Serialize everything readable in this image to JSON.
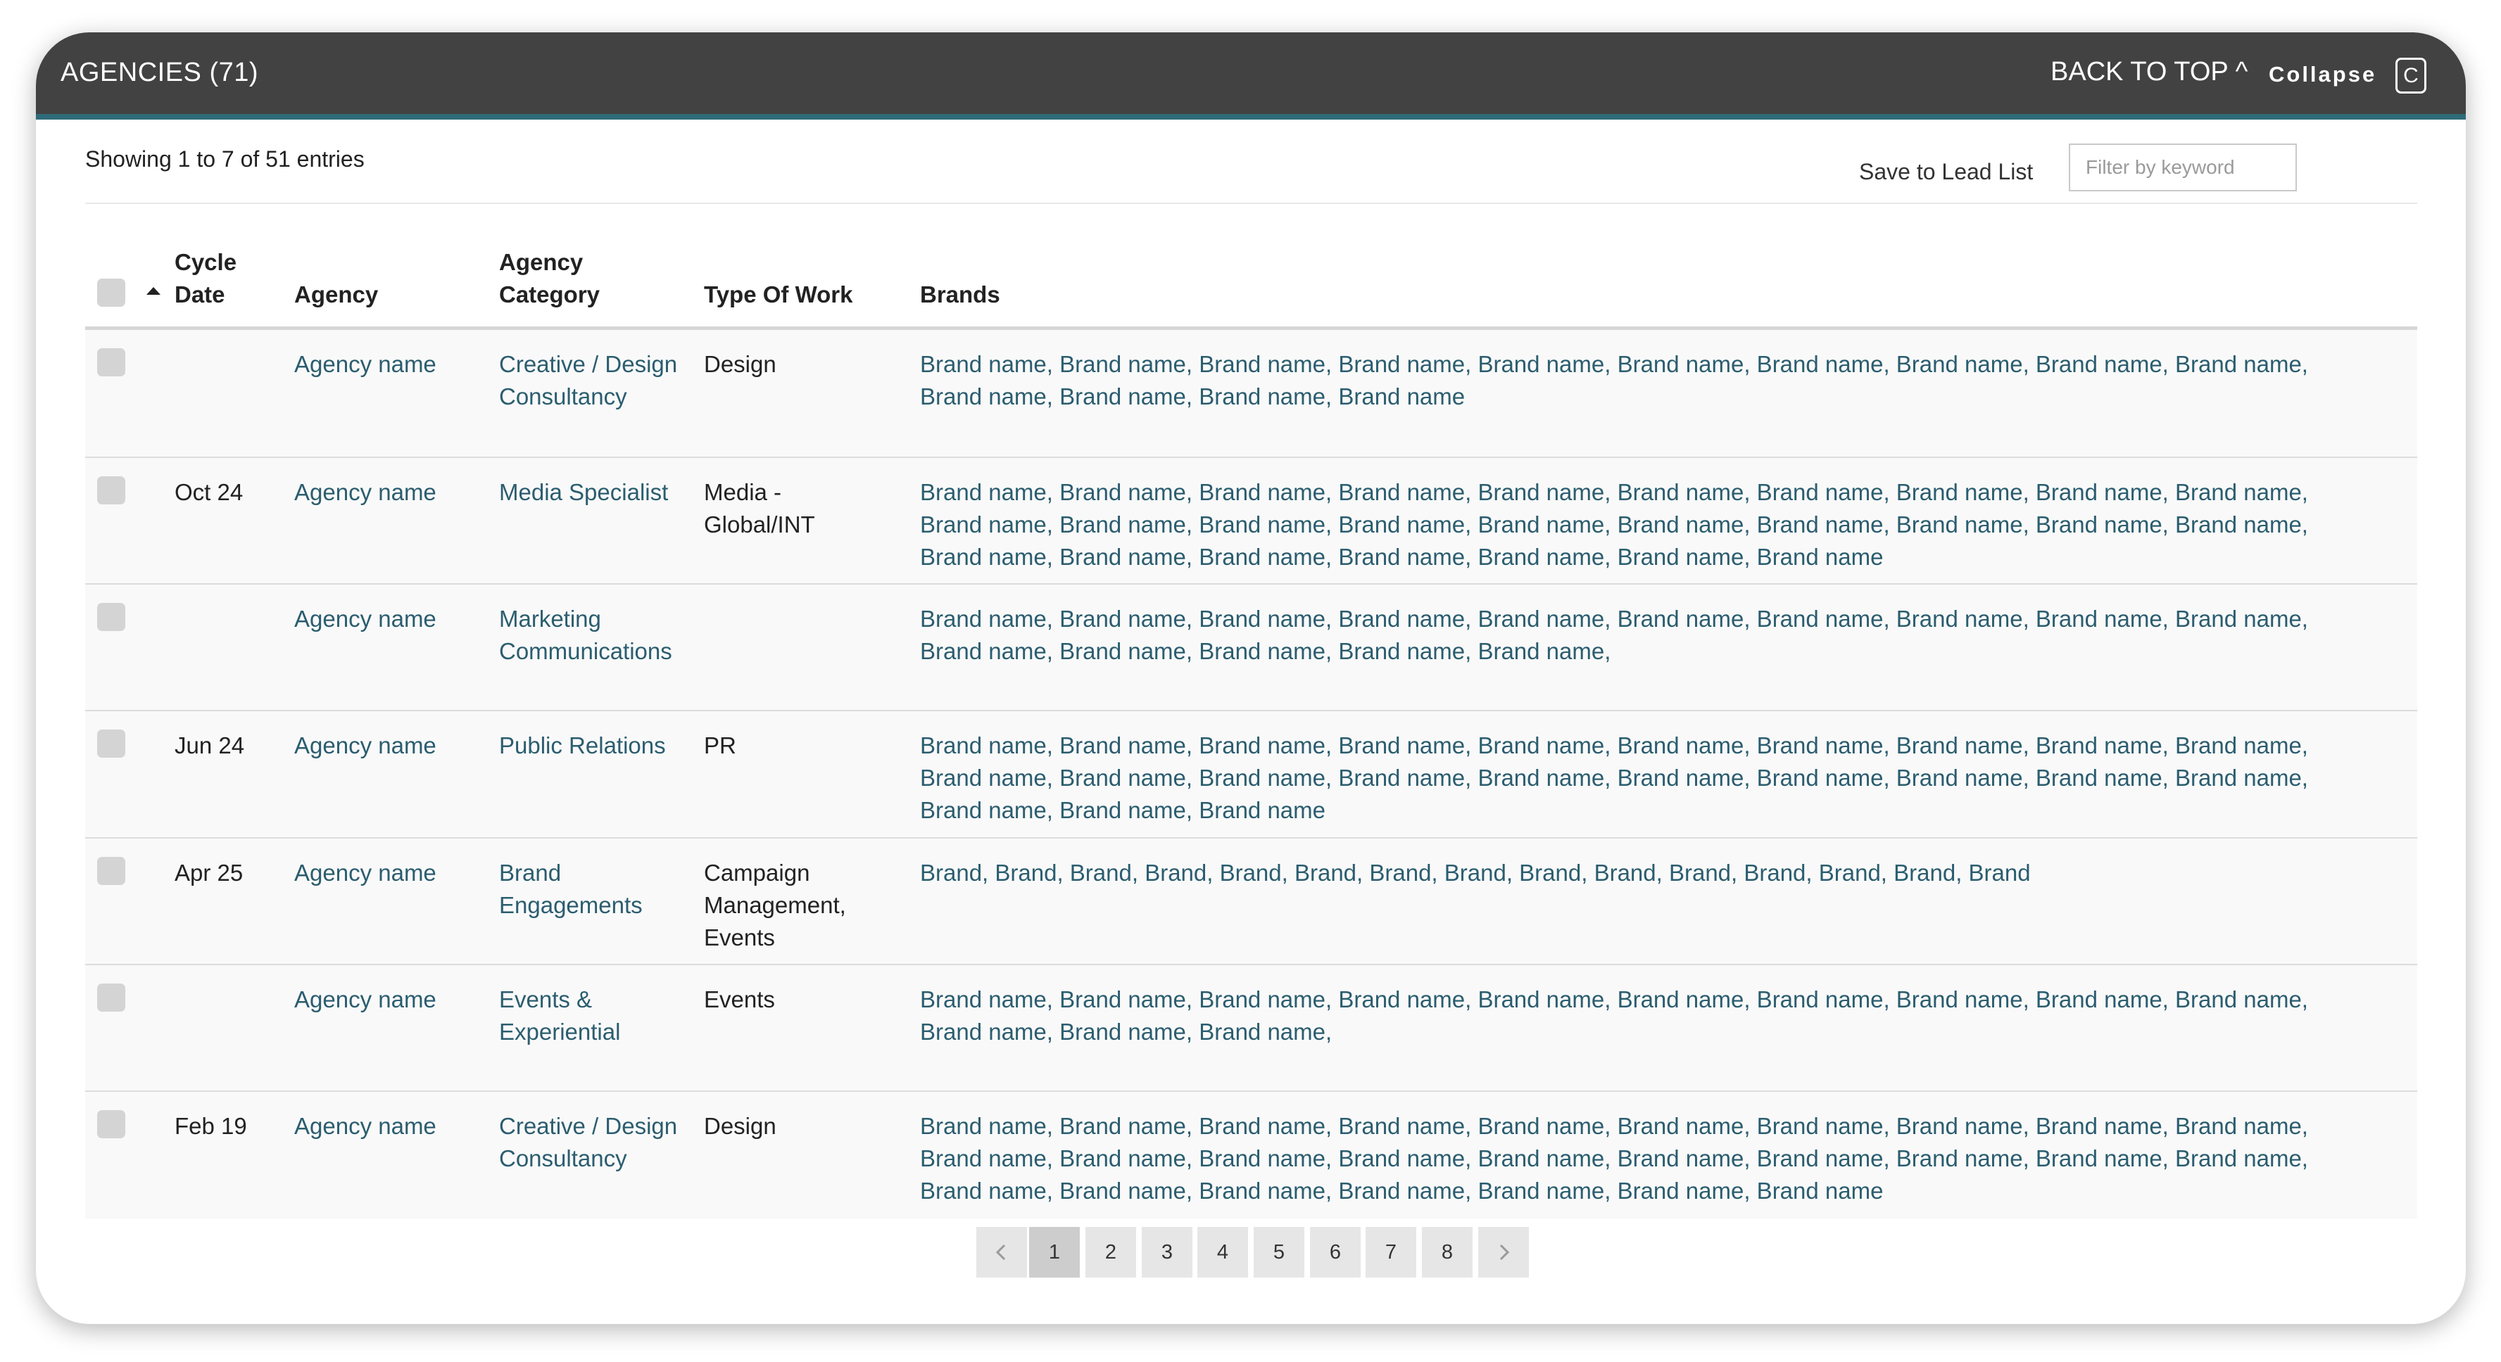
{
  "header": {
    "title": "AGENCIES (71)",
    "back_to_top": "BACK TO TOP ^",
    "collapse": "Collapse",
    "collapse_icon_glyph": "C"
  },
  "toolbar": {
    "showing": "Showing 1 to 7 of 51 entries",
    "save_to_lead_list": "Save to Lead List",
    "filter_placeholder": "Filter by keyword"
  },
  "table": {
    "columns": {
      "cycle_date_1": "Cycle",
      "cycle_date_2": "Date",
      "agency": "Agency",
      "agency_category_1": "Agency",
      "agency_category_2": "Category",
      "type_of_work": "Type Of Work",
      "brands": "Brands"
    },
    "sort_icon": "sort-ascending-icon",
    "rows": [
      {
        "date": "",
        "agency": "Agency name",
        "category_1": "Creative / Design",
        "category_2": "Consultancy",
        "category_3": "",
        "work_1": "Design",
        "work_2": "",
        "work_3": "",
        "brands_1": "Brand name, Brand name, Brand name, Brand name, Brand name, Brand name, Brand name, Brand name, Brand name, Brand name,",
        "brands_2": "Brand name, Brand name, Brand name, Brand name",
        "brands_3": ""
      },
      {
        "date": "Oct 24",
        "agency": "Agency name",
        "category_1": "Media Specialist",
        "category_2": "",
        "category_3": "",
        "work_1": "Media -",
        "work_2": "Global/INT",
        "work_3": "",
        "brands_1": "Brand name, Brand name, Brand name, Brand name, Brand name, Brand name, Brand name, Brand name, Brand name, Brand name,",
        "brands_2": "Brand name, Brand name, Brand name, Brand name, Brand name, Brand name, Brand name, Brand name, Brand name, Brand name,",
        "brands_3": "Brand name, Brand name, Brand name, Brand name, Brand name, Brand name, Brand name"
      },
      {
        "date": "",
        "agency": "Agency name",
        "category_1": "Marketing",
        "category_2": "Communications",
        "category_3": "",
        "work_1": "",
        "work_2": "",
        "work_3": "",
        "brands_1": "Brand name, Brand name, Brand name, Brand name, Brand name, Brand name, Brand name, Brand name, Brand name, Brand name,",
        "brands_2": "Brand name, Brand name, Brand name, Brand name, Brand name,",
        "brands_3": ""
      },
      {
        "date": "Jun 24",
        "agency": "Agency name",
        "category_1": "Public Relations",
        "category_2": "",
        "category_3": "",
        "work_1": "PR",
        "work_2": "",
        "work_3": "",
        "brands_1": "Brand name, Brand name, Brand name, Brand name, Brand name, Brand name, Brand name, Brand name, Brand name, Brand name,",
        "brands_2": "Brand name, Brand name, Brand name, Brand name, Brand name, Brand name, Brand name, Brand name, Brand name, Brand name,",
        "brands_3": "Brand name, Brand name, Brand name"
      },
      {
        "date": "Apr 25",
        "agency": "Agency name",
        "category_1": "Brand",
        "category_2": "Engagements",
        "category_3": "",
        "work_1": "Campaign",
        "work_2": "Management,",
        "work_3": "Events",
        "brands_1": "Brand, Brand, Brand, Brand, Brand, Brand, Brand, Brand, Brand, Brand, Brand, Brand, Brand, Brand, Brand",
        "brands_2": "",
        "brands_3": ""
      },
      {
        "date": "",
        "agency": "Agency name",
        "category_1": "Events &",
        "category_2": "Experiential",
        "category_3": "",
        "work_1": "Events",
        "work_2": "",
        "work_3": "",
        "brands_1": "Brand name, Brand name, Brand name, Brand name, Brand name, Brand name, Brand name, Brand name, Brand name, Brand name,",
        "brands_2": "Brand name, Brand name, Brand name,",
        "brands_3": ""
      },
      {
        "date": "Feb 19",
        "agency": "Agency name",
        "category_1": "Creative / Design",
        "category_2": "Consultancy",
        "category_3": "",
        "work_1": "Design",
        "work_2": "",
        "work_3": "",
        "brands_1": "Brand name, Brand name, Brand name, Brand name, Brand name, Brand name, Brand name, Brand name, Brand name, Brand name,",
        "brands_2": "Brand name, Brand name, Brand name, Brand name, Brand name, Brand name, Brand name, Brand name, Brand name, Brand name,",
        "brands_3": "Brand name, Brand name, Brand name, Brand name, Brand name, Brand name, Brand name"
      }
    ]
  },
  "pagination": {
    "prev_icon": "chevron-left-icon",
    "next_icon": "chevron-right-icon",
    "pages": [
      "1",
      "2",
      "3",
      "4",
      "5",
      "6",
      "7",
      "8"
    ],
    "current": "1"
  },
  "colors": {
    "header_bg": "#424242",
    "header_accent": "#2e6b78",
    "link_text": "#2b5d6f",
    "row_bg": "#f9f9f9"
  }
}
